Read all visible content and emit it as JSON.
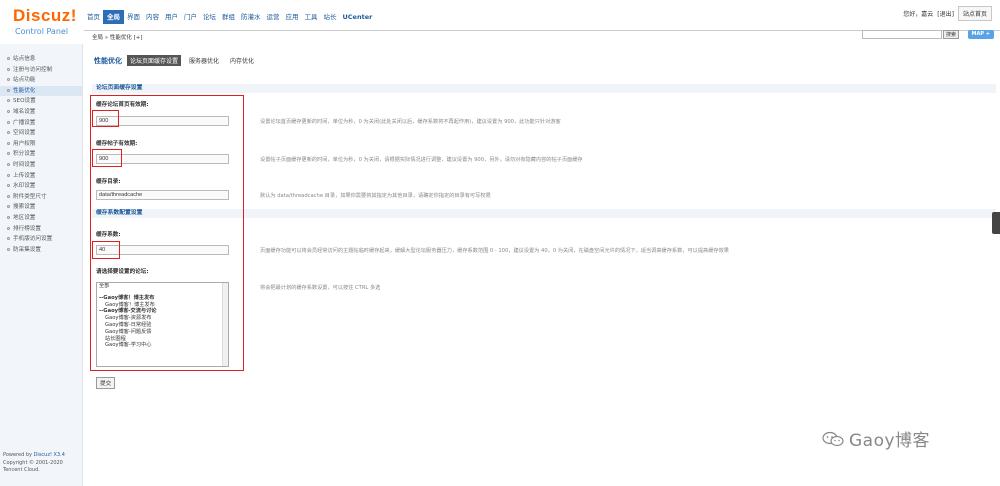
{
  "header": {
    "brand": "Discuz!",
    "subtitle": "Control Panel",
    "nav": [
      "首页",
      "全局",
      "界面",
      "内容",
      "用户",
      "门户",
      "论坛",
      "群组",
      "防灌水",
      "运营",
      "应用",
      "工具",
      "站长",
      "UCenter"
    ],
    "active_nav_index": 1,
    "greeting": "您好，嘉云",
    "logout": "[退出]",
    "home_link": "站点首页"
  },
  "crumb": {
    "path": "全局 » 性能优化 [+]",
    "search_placeholder": "",
    "search_button": "搜索",
    "map_button": "MAP +"
  },
  "sidebar": {
    "items": [
      "站点信息",
      "注册与访问控制",
      "站点功能",
      "性能优化",
      "SEO设置",
      "域名设置",
      "广播设置",
      "空间设置",
      "用户权限",
      "积分设置",
      "时间设置",
      "上传设置",
      "水印设置",
      "附件类型尺寸",
      "搜索设置",
      "地区设置",
      "排行榜设置",
      "手机版访问设置",
      "防采集设置"
    ],
    "active_index": 3
  },
  "footer": {
    "powered": "Powered by",
    "product": "Discuz! X3.4",
    "copyright": "Copyright © 2001-2020",
    "company": "Tencent Cloud."
  },
  "page": {
    "title": "性能优化",
    "tabs": [
      "论坛页面缓存设置",
      "服务器优化",
      "内存优化"
    ],
    "active_tab": 0
  },
  "section1": {
    "heading": "论坛页面缓存设置",
    "fields": [
      {
        "label": "缓存论坛首页有效期:",
        "value": "900",
        "help": "设置论坛首页缓存更新的时间，单位为秒，0 为关闭(此处关闭以后，缓存系数将不再起作用)，建议设置为 900，此功能只针对游客"
      },
      {
        "label": "缓存帖子有效期:",
        "value": "900",
        "help": "设置帖子页面缓存更新的时间，单位为秒，0 为关闭，请根据实际情况进行调整，建议设置为 900，另外，请勿对有隐藏内容的帖子页面缓存"
      },
      {
        "label": "缓存目录:",
        "value": "data/threadcache",
        "help": "默认为 data/threadcache 目录，如果你需要将其指定为其他目录，请确定你指定的目录有可写权限"
      }
    ]
  },
  "section2": {
    "heading": "缓存系数配置设置",
    "fields": [
      {
        "label": "缓存系数:",
        "value": "40",
        "help": "页面缓存功能可以将会员经常访问的主题帖临时缓存起来，缓解大型论坛服务器压力，缓存系数范围 0 - 100，建议设置为 40，0 为关闭，在磁盘空间允许的情况下，适当调高缓存系数，可以提高缓存效果"
      }
    ]
  },
  "forum_select": {
    "label": "请选择要设置的论坛:",
    "help": "将会把最计划的缓存系数设置，可以按住 CTRL 多选",
    "options": [
      {
        "text": "全部",
        "type": "all"
      },
      {
        "text": "",
        "type": "blank"
      },
      {
        "text": "--Gaoy博客！博主发布",
        "type": "group"
      },
      {
        "text": "Gaoy博客！博主发布",
        "type": "forum"
      },
      {
        "text": "--Gaoy博客-交流与讨论",
        "type": "group"
      },
      {
        "text": "Gaoy博客-资源发布",
        "type": "forum"
      },
      {
        "text": "Gaoy博客-日常经验",
        "type": "forum"
      },
      {
        "text": "Gaoy博客-问题反馈",
        "type": "forum"
      },
      {
        "text": "站长圈程",
        "type": "forum"
      },
      {
        "text": "Gaoy博客-学习中心",
        "type": "forum"
      }
    ],
    "submit": "提交"
  },
  "watermark": {
    "text": "Gaoy博客"
  },
  "colors": {
    "accent": "#2d6db5",
    "highlight": "#e02020",
    "brand_orange": "#ff6600"
  }
}
